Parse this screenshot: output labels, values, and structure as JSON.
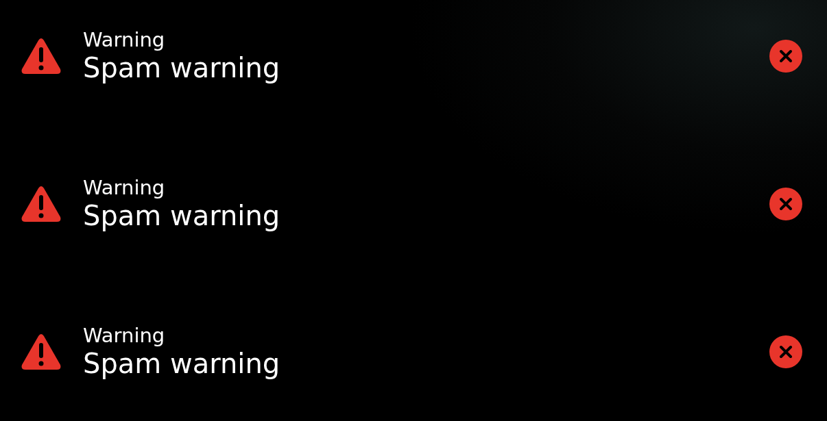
{
  "notifications": [
    {
      "title": "Warning",
      "message": "Spam warning"
    },
    {
      "title": "Warning",
      "message": "Spam warning"
    },
    {
      "title": "Warning",
      "message": "Spam warning"
    }
  ]
}
